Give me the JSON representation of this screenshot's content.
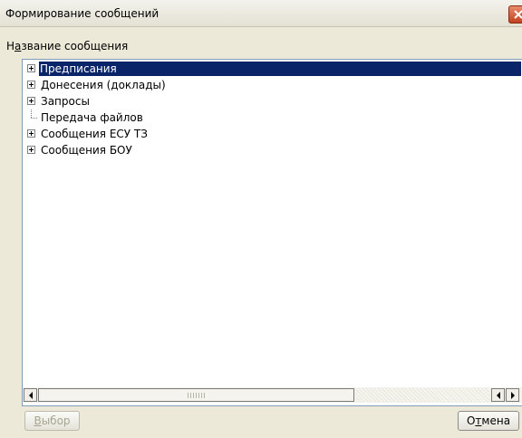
{
  "window": {
    "title": "Формирование сообщений"
  },
  "section": {
    "label_pre": "Н",
    "label_mnemonic": "а",
    "label_post": "звание сообщения"
  },
  "tree": {
    "items": [
      {
        "label": "Предписания",
        "expandable": true,
        "selected": true
      },
      {
        "label": "Донесения (доклады)",
        "expandable": true,
        "selected": false
      },
      {
        "label": "Запросы",
        "expandable": true,
        "selected": false
      },
      {
        "label": "Передача файлов",
        "expandable": false,
        "selected": false
      },
      {
        "label": "Сообщения ЕСУ ТЗ",
        "expandable": true,
        "selected": false
      },
      {
        "label": "Сообщения БОУ",
        "expandable": true,
        "selected": false
      }
    ]
  },
  "buttons": {
    "select_pre": "",
    "select_mnemonic": "В",
    "select_post": "ыбор",
    "select_enabled": false,
    "cancel_pre": "О",
    "cancel_mnemonic": "т",
    "cancel_post": "мена"
  },
  "colors": {
    "selection": "#0a246a",
    "window_bg": "#ece9d8",
    "disabled_text": "#a7a591"
  },
  "icons": {
    "close": "close-icon",
    "expander": "plus-box-icon",
    "scroll_left": "arrow-left-icon",
    "scroll_right": "arrow-right-icon"
  }
}
